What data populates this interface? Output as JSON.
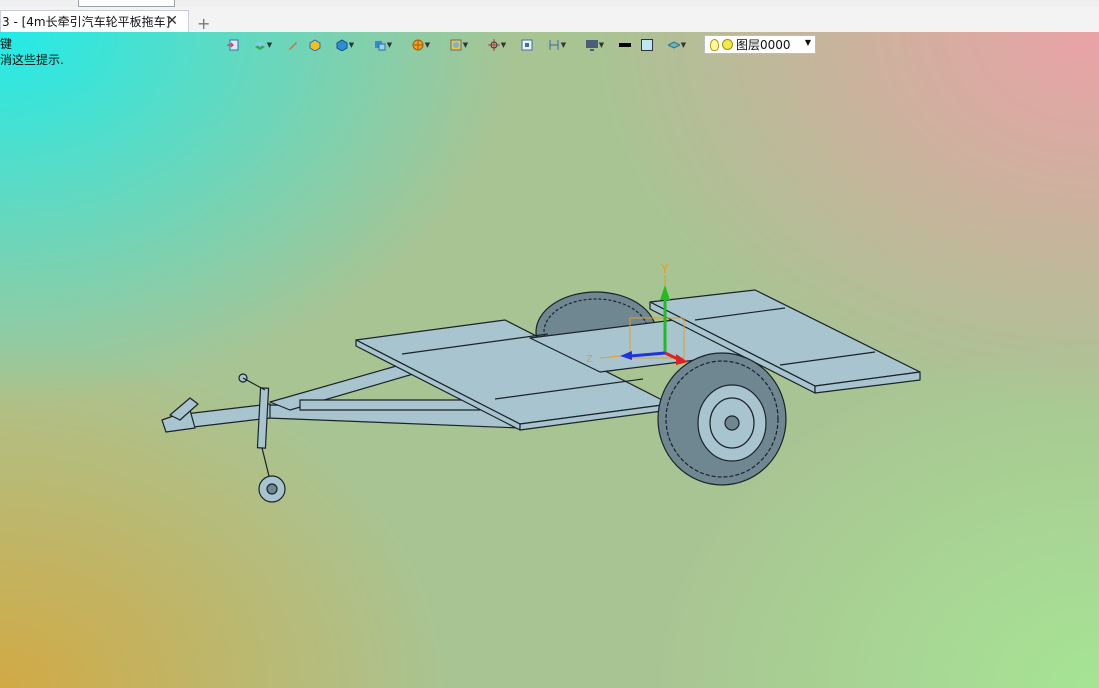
{
  "tab": {
    "title": "3 - [4m长牵引汽车轮平板拖车]",
    "close_glyph": "✕",
    "new_glyph": "+"
  },
  "hint": {
    "line1": "键",
    "line2": "消这些提示."
  },
  "layer_selector": {
    "value": "图层0000"
  },
  "axes": {
    "y_label": "Y",
    "z_label": "Z"
  },
  "colors": {
    "model_fill": "#a7c4cf",
    "model_stroke": "#1b2328",
    "tire": "#6f8791",
    "axis_y": "#22bb22",
    "axis_z": "#2233dd",
    "axis_x": "#dd2222",
    "axis_label": "#e0a020"
  },
  "toolbar": {
    "icons": [
      "import-icon",
      "layers-stack-icon",
      "pen-icon",
      "box-yellow-icon",
      "solid-box-icon",
      "view-cube-icon",
      "render-sphere-icon",
      "display-mode-icon",
      "move-axis-icon",
      "frame-icon",
      "dimension-icon",
      "screen-icon",
      "line-color-icon",
      "fill-color-icon",
      "layer-stack-icon"
    ]
  }
}
